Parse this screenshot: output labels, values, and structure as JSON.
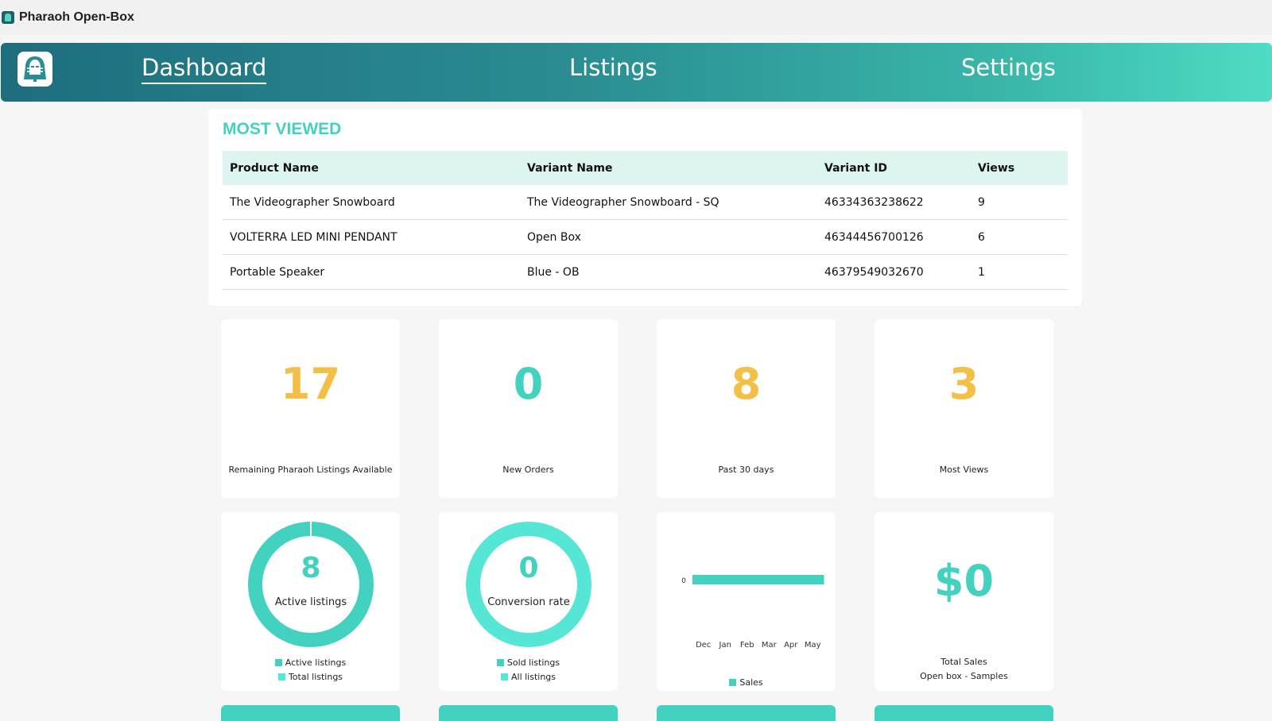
{
  "app": {
    "title": "Pharaoh Open-Box"
  },
  "nav": {
    "tabs": [
      {
        "label": "Dashboard",
        "active": true
      },
      {
        "label": "Listings",
        "active": false
      },
      {
        "label": "Settings",
        "active": false
      }
    ]
  },
  "colors": {
    "teal": "#42d2bf",
    "yellow": "#f4bf47",
    "header_bg": "#dcf5f1",
    "light_teal": "#55e6d6"
  },
  "most_viewed": {
    "title": "MOST VIEWED",
    "columns": [
      "Product Name",
      "Variant Name",
      "Variant ID",
      "Views"
    ],
    "rows": [
      [
        "The Videographer Snowboard",
        "The Videographer Snowboard - SQ",
        "46334363238622",
        "9"
      ],
      [
        "VOLTERRA LED MINI PENDANT",
        "Open Box",
        "46344456700126",
        "6"
      ],
      [
        "Portable Speaker",
        "Blue - OB",
        "46379549032670",
        "1"
      ]
    ]
  },
  "stats": [
    {
      "value": "17",
      "label": "Remaining Pharaoh Listings Available",
      "color": "yellow"
    },
    {
      "value": "0",
      "label": "New Orders",
      "color": "teal"
    },
    {
      "value": "8",
      "label": "Past 30 days",
      "color": "yellow"
    },
    {
      "value": "3",
      "label": "Most Views",
      "color": "yellow"
    }
  ],
  "active_listings": {
    "value": "8",
    "label": "Active listings",
    "legend": [
      "Active listings",
      "Total listings"
    ]
  },
  "conversion": {
    "value": "0",
    "label": "Conversion rate",
    "legend": [
      "Sold listings",
      "All listings"
    ]
  },
  "total_sales": {
    "value": "$0",
    "label": "Total Sales",
    "sublabel": "Open box - Samples"
  },
  "chart_data": {
    "type": "bar",
    "categories": [
      "Dec",
      "Jan",
      "Feb",
      "Mar",
      "Apr",
      "May"
    ],
    "series": [
      {
        "name": "Sales",
        "values": [
          0,
          0,
          0,
          0,
          0,
          0
        ]
      }
    ],
    "y_tick_labels": [
      "0"
    ],
    "title": "",
    "xlabel": "",
    "ylabel": "",
    "legend": "bottom"
  }
}
